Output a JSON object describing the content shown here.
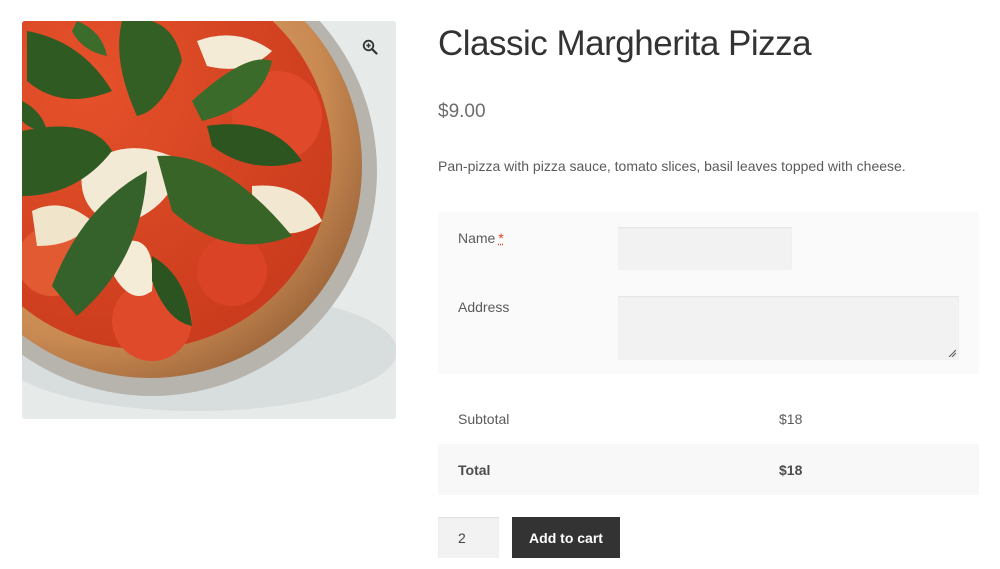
{
  "product": {
    "title": "Classic Margherita Pizza",
    "price": "$9.00",
    "description": "Pan-pizza with pizza sauce, tomato slices, basil leaves topped with cheese.",
    "image_alt": "Margherita pizza"
  },
  "gallery": {
    "zoom_icon": "zoom-in-icon"
  },
  "addons": {
    "name_label": "Name",
    "required_mark": "*",
    "address_label": "Address",
    "name_value": "",
    "address_value": ""
  },
  "totals": {
    "subtotal_label": "Subtotal",
    "subtotal_value": "$18",
    "total_label": "Total",
    "total_value": "$18"
  },
  "cart": {
    "quantity": "2",
    "add_label": "Add to cart"
  },
  "colors": {
    "accent_dark": "#333333",
    "required": "#e2401c",
    "price": "#6d6d6d"
  }
}
